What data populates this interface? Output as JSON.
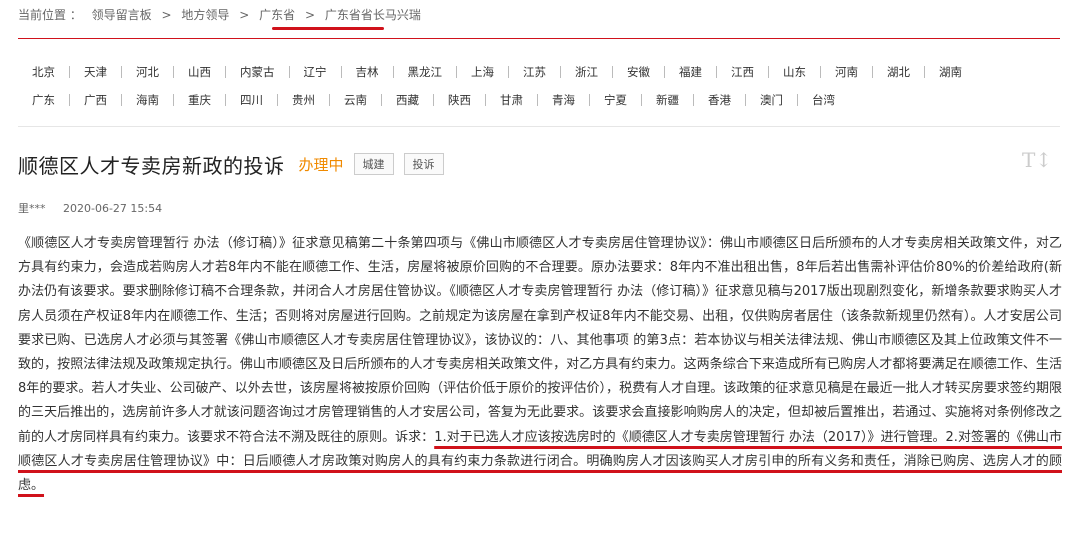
{
  "breadcrumb": {
    "label": "当前位置 ：",
    "items": [
      "领导留言板",
      "地方领导",
      "广东省"
    ],
    "separator": ">",
    "current": "广东省省长马兴瑞"
  },
  "regions": {
    "row1": [
      "北京",
      "天津",
      "河北",
      "山西",
      "内蒙古",
      "辽宁",
      "吉林",
      "黑龙江",
      "上海",
      "江苏",
      "浙江",
      "安徽",
      "福建",
      "江西",
      "山东",
      "河南",
      "湖北",
      "湖南"
    ],
    "row2": [
      "广东",
      "广西",
      "海南",
      "重庆",
      "四川",
      "贵州",
      "云南",
      "西藏",
      "陕西",
      "甘肃",
      "青海",
      "宁夏",
      "新疆",
      "香港",
      "澳门",
      "台湾"
    ]
  },
  "post": {
    "title": "顺德区人才专卖房新政的投诉",
    "status": "办理中",
    "tags": [
      "城建",
      "投诉"
    ],
    "font_toggle": "T↕",
    "author": "里***",
    "datetime": "2020-06-27 15:54",
    "body": "《顺德区人才专卖房管理暂行 办法（修订稿）》征求意见稿第二十条第四项与《佛山市顺德区人才专卖房居住管理协议》：佛山市顺德区日后所颁布的人才专卖房相关政策文件，对乙方具有约束力，会造成若购房人才若8年内不能在顺德工作、生活，房屋将被原价回购的不合理要。原办法要求：8年内不准出租出售，8年后若出售需补评估价80%的价差给政府(新办法仍有该要求。要求删除修订稿不合理条款，并闭合人才房居住管协议。《顺德区人才专卖房管理暂行 办法（修订稿）》征求意见稿与2017版出现剧烈变化，新增条款要求购买人才房人员须在产权证8年内在顺德工作、生活；否则将对房屋进行回购。之前规定为该房屋在拿到产权证8年内不能交易、出租，仅供购房者居住（该条款新规里仍然有）。人才安居公司要求已购、已选房人才必须与其签署《佛山市顺德区人才专卖房居住管理协议》，该协议的：八、其他事项 的第3点：若本协议与相关法律法规、佛山市顺德区及其上位政策文件不一致的，按照法律法规及政策规定执行。佛山市顺德区及日后所颁布的人才专卖房相关政策文件，对乙方具有约束力。这两条综合下来造成所有已购房人才都将要满足在顺德工作、生活8年的要求。若人才失业、公司破产、以外去世，该房屋将被按原价回购（评估价低于原价的按评估价），税费有人才自理。该政策的征求意见稿是在最近一批人才转买房要求签约期限的三天后推出的，选房前许多人才就该问题咨询过才房管理销售的人才安居公司，答复为无此要求。该要求会直接影响购房人的决定，但却被后置推出，若通过、实施将对条例修改之前的人才房同样具有约束力。该要求不符合法不溯及既往的原则。",
    "request_label": "诉求：",
    "request_text": "1.对于已选人才应该按选房时的《顺德区人才专卖房管理暂行 办法（2017）》进行管理。2.对签署的《佛山市顺德区人才专卖房居住管理协议》中：日后顺德人才房政策对购房人的具有约束力条款进行闭合。明确购房人才因该购买人才房引申的所有义务和责任，消除已购房、选房人才的顾虑。"
  },
  "colors": {
    "accent_red": "#d0121b",
    "status_orange": "#f08a00"
  }
}
